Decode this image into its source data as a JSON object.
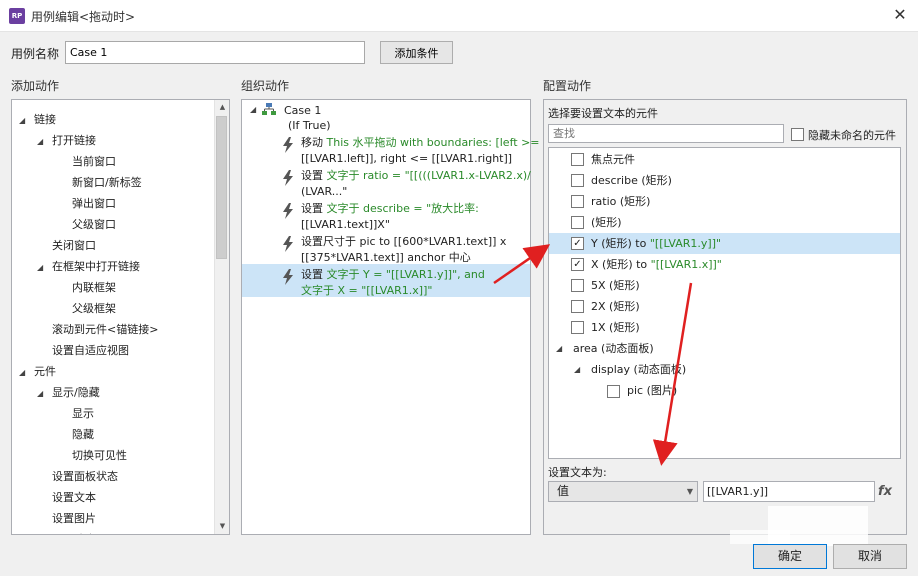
{
  "window": {
    "title": "用例编辑<拖动时>",
    "app_icon": "RP",
    "close": "✕"
  },
  "case_name": {
    "label": "用例名称",
    "value": "Case 1",
    "add_condition_label": "添加条件"
  },
  "sections": {
    "add_action": "添加动作",
    "organize_action": "组织动作",
    "configure_action": "配置动作"
  },
  "left_tree": [
    {
      "label": "链接",
      "level": 0,
      "expander": true
    },
    {
      "label": "打开链接",
      "level": 1,
      "expander": true
    },
    {
      "label": "当前窗口",
      "level": 2,
      "expander": false
    },
    {
      "label": "新窗口/新标签",
      "level": 2,
      "expander": false
    },
    {
      "label": "弹出窗口",
      "level": 2,
      "expander": false
    },
    {
      "label": "父级窗口",
      "level": 2,
      "expander": false
    },
    {
      "label": "关闭窗口",
      "level": 1,
      "expander": false
    },
    {
      "label": "在框架中打开链接",
      "level": 1,
      "expander": true
    },
    {
      "label": "内联框架",
      "level": 2,
      "expander": false
    },
    {
      "label": "父级框架",
      "level": 2,
      "expander": false
    },
    {
      "label": "滚动到元件<锚链接>",
      "level": 1,
      "expander": false
    },
    {
      "label": "设置自适应视图",
      "level": 1,
      "expander": false
    },
    {
      "label": "元件",
      "level": 0,
      "expander": true
    },
    {
      "label": "显示/隐藏",
      "level": 1,
      "expander": true
    },
    {
      "label": "显示",
      "level": 2,
      "expander": false
    },
    {
      "label": "隐藏",
      "level": 2,
      "expander": false
    },
    {
      "label": "切换可见性",
      "level": 2,
      "expander": false
    },
    {
      "label": "设置面板状态",
      "level": 1,
      "expander": false
    },
    {
      "label": "设置文本",
      "level": 1,
      "expander": false
    },
    {
      "label": "设置图片",
      "level": 1,
      "expander": false
    },
    {
      "label": "设置选中",
      "level": 1,
      "expander": true
    }
  ],
  "middle": {
    "case_title": "Case 1",
    "condition": "(If True)",
    "actions": [
      {
        "verb": "移动",
        "detail_line1": "This 水平拖动 with boundaries: [left >=",
        "detail_line2": "[[LVAR1.left]], right <= [[LVAR1.right]]",
        "green_line1": true
      },
      {
        "verb": "设置",
        "detail_line1": "文字于 ratio = \"[[(((LVAR1.x-LVAR2.x)/",
        "detail_line2": "(LVAR...\"",
        "green_line1": true
      },
      {
        "verb": "设置",
        "detail_line1": "文字于 describe = \"放大比率:",
        "detail_line2": "[[LVAR1.text]]X\"",
        "green_line1": true
      },
      {
        "verb": "设置尺寸于",
        "detail_line1": "pic to [[600*LVAR1.text]] x",
        "detail_line2": "[[375*LVAR1.text]] anchor 中心",
        "green_line1": false
      },
      {
        "verb": "设置",
        "detail_line1": "文字于 Y = \"[[LVAR1.y]]\", and",
        "detail_line2": "文字于 X = \"[[LVAR1.x]]\"",
        "green_line1": true
      }
    ]
  },
  "right": {
    "choose_label": "选择要设置文本的元件",
    "search_placeholder": "查找",
    "hide_unnamed_label": "隐藏未命名的元件",
    "items": [
      {
        "label": "焦点元件",
        "checked": false
      },
      {
        "label": "describe (矩形)",
        "checked": false
      },
      {
        "label": "ratio (矩形)",
        "checked": false
      },
      {
        "label": "(矩形)",
        "checked": false
      },
      {
        "label": "Y (矩形) to ",
        "value": "\"[[LVAR1.y]]\"",
        "checked": true
      },
      {
        "label": "X (矩形) to ",
        "value": "\"[[LVAR1.x]]\"",
        "checked": true
      },
      {
        "label": "5X (矩形)",
        "checked": false
      },
      {
        "label": "2X (矩形)",
        "checked": false
      },
      {
        "label": "1X (矩形)",
        "checked": false
      }
    ],
    "area_group": "area (动态面板)",
    "display_group": "display (动态面板)",
    "pic_item": "pic (图片)",
    "set_text_as_label": "设置文本为:",
    "value_type": "值",
    "value_text": "[[LVAR1.y]]",
    "fx": "fx"
  },
  "buttons": {
    "ok": "确定",
    "cancel": "取消"
  },
  "colors": {
    "arrow": "#e02020",
    "selection": "#cce4f7",
    "green_text": "#2a8a2a"
  }
}
